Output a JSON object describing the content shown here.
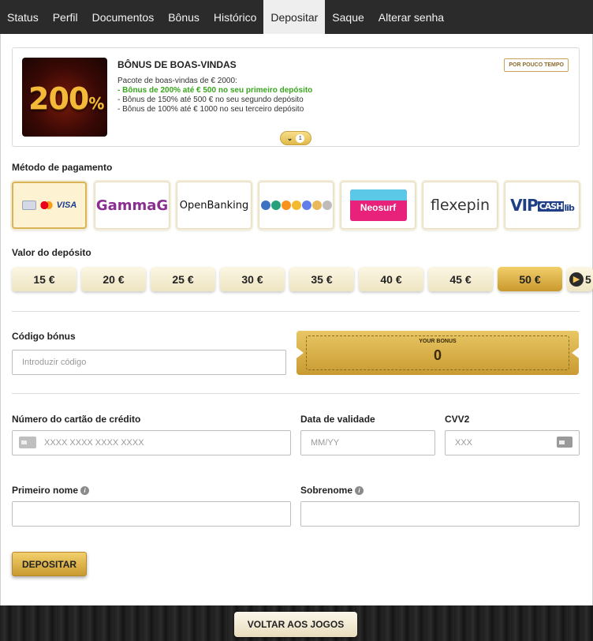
{
  "tabs": [
    {
      "label": "Status"
    },
    {
      "label": "Perfil"
    },
    {
      "label": "Documentos"
    },
    {
      "label": "Bônus"
    },
    {
      "label": "Histórico"
    },
    {
      "label": "Depositar",
      "active": true
    },
    {
      "label": "Saque"
    },
    {
      "label": "Alterar senha"
    }
  ],
  "bonus": {
    "image_text": "200",
    "image_suffix": "%",
    "title": "BÔNUS DE BOAS-VINDAS",
    "badge": "POR POUCO TEMPO",
    "intro": "Pacote de boas-vindas de € 2000:",
    "line1": "- Bônus de 200% até € 500 no seu primeiro depósito",
    "line2": "- Bônus de 150% até 500 € no seu segundo depósito",
    "line3": "- Bônus de 100% até € 1000 no seu terceiro depósito",
    "count": "1"
  },
  "payment": {
    "label": "Método de pagamento",
    "methods": [
      {
        "name": "cards",
        "text": "VISA",
        "selected": true
      },
      {
        "name": "gammag",
        "text": "GammaG"
      },
      {
        "name": "openbanking",
        "text": "OpenBanking"
      },
      {
        "name": "crypto",
        "text": ""
      },
      {
        "name": "neosurf",
        "text": "Neosurf"
      },
      {
        "name": "flexepin",
        "text": "flexepin"
      },
      {
        "name": "vipcash",
        "text": "VIP",
        "text2": "CASH",
        "text3": "lib"
      }
    ]
  },
  "amount": {
    "label": "Valor do depósito",
    "options": [
      "15 €",
      "20 €",
      "25 €",
      "30 €",
      "35 €",
      "40 €",
      "45 €",
      "50 €"
    ],
    "selected": "50 €",
    "next_peek": "5"
  },
  "bonus_code": {
    "label": "Código bónus",
    "placeholder": "Introduzir código",
    "ticket_label": "YOUR BONUS",
    "ticket_value": "0"
  },
  "card": {
    "number_label": "Número do cartão de crédito",
    "number_placeholder": "XXXX XXXX XXXX XXXX",
    "expiry_label": "Data de validade",
    "expiry_placeholder": "MM/YY",
    "cvv_label": "CVV2",
    "cvv_placeholder": "XXX"
  },
  "name": {
    "first_label": "Primeiro nome",
    "last_label": "Sobrenome",
    "info_glyph": "i"
  },
  "actions": {
    "deposit": "DEPOSITAR",
    "back": "VOLTAR AOS JOGOS"
  },
  "colors": {
    "gold": "#d9b455",
    "tab_bar": "#2b2b2b",
    "green": "#3aa51f"
  }
}
